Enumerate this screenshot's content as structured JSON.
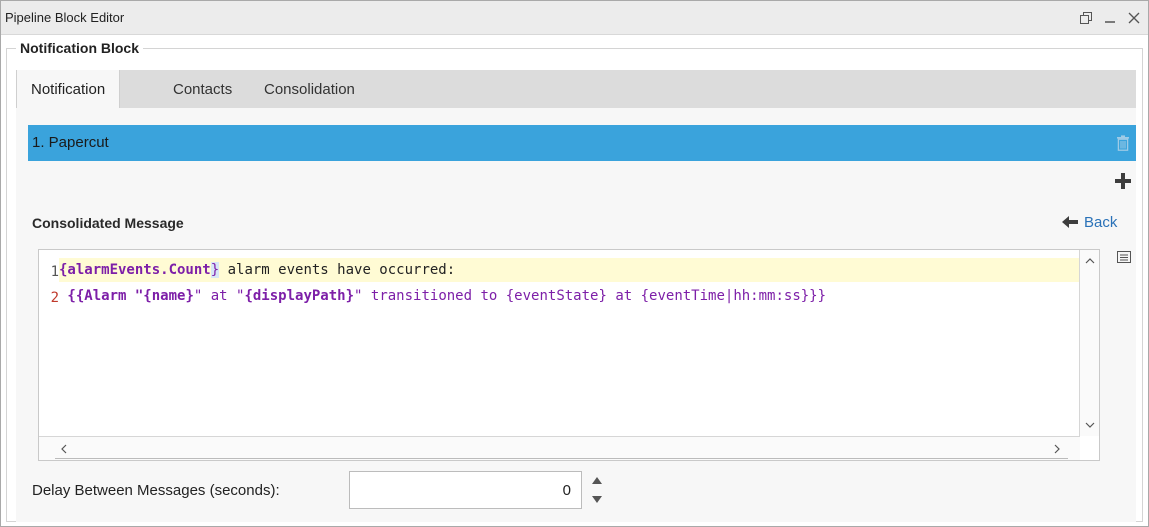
{
  "window": {
    "title": "Pipeline Block Editor",
    "controls": [
      "restore-icon",
      "minimize-icon",
      "close-icon"
    ]
  },
  "block": {
    "title": "Notification Block"
  },
  "tabs": [
    {
      "label": "Notification",
      "active": true
    },
    {
      "label": "Contacts",
      "active": false
    },
    {
      "label": "Consolidation",
      "active": false
    }
  ],
  "notification_list": {
    "items": [
      {
        "label": "1. Papercut",
        "selected": true
      }
    ],
    "selected_color": "#3aa3dc",
    "delete_icon": "trash-icon",
    "add_icon": "plus-icon"
  },
  "message": {
    "title": "Consolidated Message",
    "back_label": "Back",
    "line_numbers": [
      "1",
      "2"
    ],
    "lines": [
      {
        "tokens": [
          {
            "text": "{alarmEvents.Count",
            "style": "bold"
          },
          {
            "text": "}",
            "style": "hl"
          },
          {
            "text": " alarm events have occurred:",
            "style": "plain"
          }
        ]
      },
      {
        "tokens": [
          {
            "text": " {{Alarm \"",
            "style": "bold"
          },
          {
            "text": "{name}",
            "style": "bold"
          },
          {
            "text": "\" at \"",
            "style": "purple"
          },
          {
            "text": "{displayPath}",
            "style": "bold"
          },
          {
            "text": "\" transitioned to {eventState} at {eventTime|hh:mm:ss}}}",
            "style": "purple"
          }
        ]
      }
    ]
  },
  "delay": {
    "label": "Delay Between Messages (seconds):",
    "value": "0"
  }
}
